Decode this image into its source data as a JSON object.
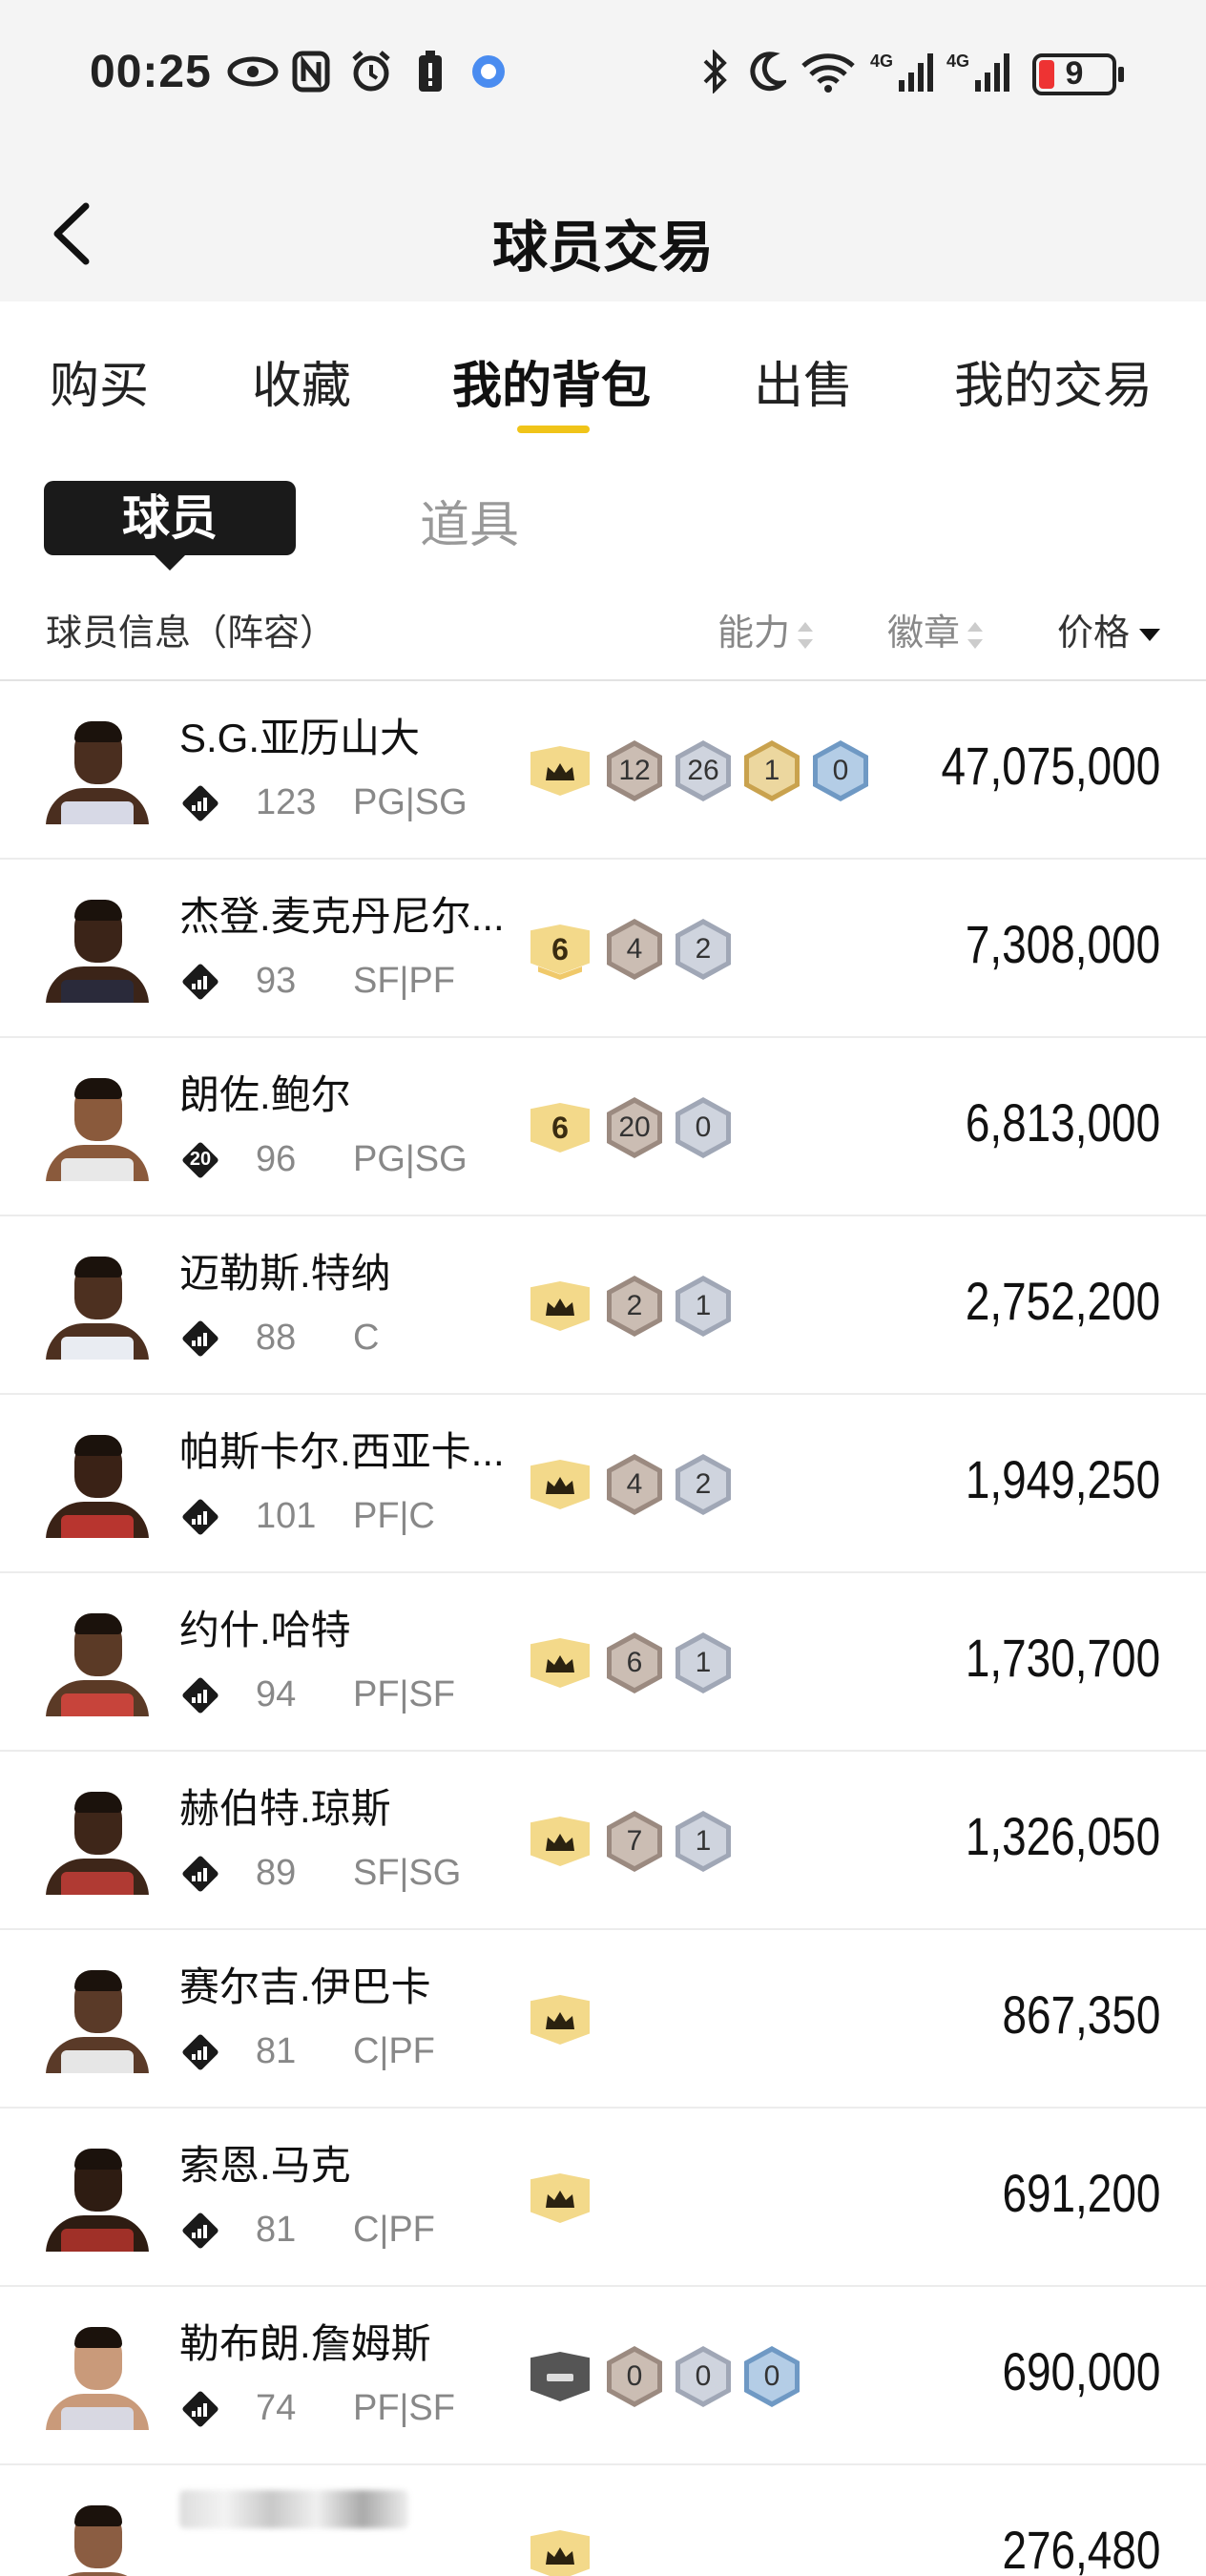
{
  "status_bar": {
    "time": "00:25",
    "battery": "9"
  },
  "header": {
    "title": "球员交易"
  },
  "tabs": [
    "购买",
    "收藏",
    "我的背包",
    "出售",
    "我的交易"
  ],
  "active_tab": "我的背包",
  "sub_tabs": {
    "active": "球员",
    "other": "道具"
  },
  "columns": {
    "info": "球员信息（阵容）",
    "ability": "能力",
    "badges": "徽章",
    "price": "价格"
  },
  "players": [
    {
      "name": "S.G.亚历山大",
      "ovr": "123",
      "pos": "PG|SG",
      "rank": "crown",
      "badges": [
        {
          "tier": "hof",
          "v": "12"
        },
        {
          "tier": "gold",
          "v": "26"
        },
        {
          "tier": "silver",
          "v": "1"
        },
        {
          "tier": "bronze",
          "v": "0"
        }
      ],
      "price": "47,075,000"
    },
    {
      "name": "杰登.麦克丹尼尔...",
      "ovr": "93",
      "pos": "SF|PF",
      "rank": "6-plus",
      "rank_label": "6",
      "badges": [
        {
          "tier": "hof",
          "v": "4"
        },
        {
          "tier": "gold",
          "v": "2"
        }
      ],
      "price": "7,308,000"
    },
    {
      "name": "朗佐.鲍尔",
      "ovr": "96",
      "pos": "PG|SG",
      "rank": "6",
      "rank_label": "6",
      "ovr_icon": "20",
      "badges": [
        {
          "tier": "hof",
          "v": "20"
        },
        {
          "tier": "gold",
          "v": "0"
        }
      ],
      "price": "6,813,000"
    },
    {
      "name": "迈勒斯.特纳",
      "ovr": "88",
      "pos": "C",
      "rank": "crown",
      "badges": [
        {
          "tier": "hof",
          "v": "2"
        },
        {
          "tier": "gold",
          "v": "1"
        }
      ],
      "price": "2,752,200"
    },
    {
      "name": "帕斯卡尔.西亚卡...",
      "ovr": "101",
      "pos": "PF|C",
      "rank": "crown",
      "badges": [
        {
          "tier": "hof",
          "v": "4"
        },
        {
          "tier": "gold",
          "v": "2"
        }
      ],
      "price": "1,949,250"
    },
    {
      "name": "约什.哈特",
      "ovr": "94",
      "pos": "PF|SF",
      "rank": "crown",
      "badges": [
        {
          "tier": "hof",
          "v": "6"
        },
        {
          "tier": "gold",
          "v": "1"
        }
      ],
      "price": "1,730,700"
    },
    {
      "name": "赫伯特.琼斯",
      "ovr": "89",
      "pos": "SF|SG",
      "rank": "crown",
      "badges": [
        {
          "tier": "hof",
          "v": "7"
        },
        {
          "tier": "gold",
          "v": "1"
        }
      ],
      "price": "1,326,050"
    },
    {
      "name": "赛尔吉.伊巴卡",
      "ovr": "81",
      "pos": "C|PF",
      "rank": "crown",
      "badges": [],
      "price": "867,350"
    },
    {
      "name": "索恩.马克",
      "ovr": "81",
      "pos": "C|PF",
      "rank": "crown",
      "badges": [],
      "price": "691,200"
    },
    {
      "name": "勒布朗.詹姆斯",
      "ovr": "74",
      "pos": "PF|SF",
      "rank": "gray",
      "badges": [
        {
          "tier": "hof",
          "v": "0"
        },
        {
          "tier": "gold",
          "v": "0"
        },
        {
          "tier": "bronze",
          "v": "0"
        }
      ],
      "price": "690,000"
    },
    {
      "name": "",
      "ovr": "",
      "pos": "",
      "rank": "crown",
      "badges": [],
      "price": "276,480",
      "blurred": true
    }
  ]
}
